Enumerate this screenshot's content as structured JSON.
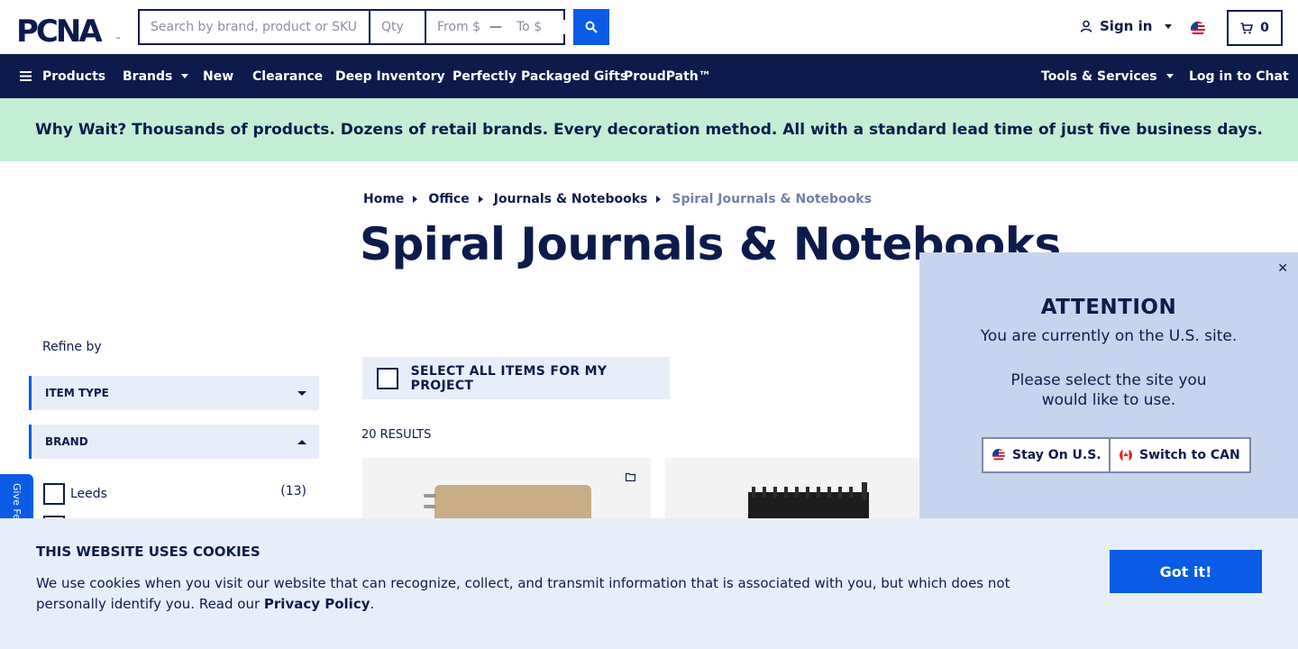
{
  "header": {
    "logo_text": "PCNA",
    "search_placeholder": "Search by brand, product or SKU",
    "qty_placeholder": "Qty",
    "price_from_placeholder": "From $",
    "price_to_placeholder": "To $",
    "signin_label": "Sign in",
    "cart_count": "0"
  },
  "nav": {
    "products": "Products",
    "brands": "Brands",
    "new": "New",
    "clearance": "Clearance",
    "deep_inventory": "Deep Inventory",
    "packaged_gifts": "Perfectly Packaged Gifts",
    "proudpath": "ProudPath™",
    "tools": "Tools & Services",
    "chat": "Log in to Chat"
  },
  "banner": {
    "text": "Why Wait? Thousands of products. Dozens of retail brands. Every decoration method. All with a standard lead time of just five business days."
  },
  "breadcrumb": {
    "items": [
      "Home",
      "Office",
      "Journals & Notebooks"
    ],
    "current": "Spiral Journals & Notebooks"
  },
  "page_title": "Spiral Journals & Notebooks",
  "sidebar": {
    "refine_label": "Refine by",
    "facets": [
      {
        "label": "ITEM TYPE",
        "state": "collapsed"
      },
      {
        "label": "BRAND",
        "state": "expanded"
      }
    ],
    "brand_options": [
      {
        "label": "Leeds",
        "count": "(13)"
      }
    ],
    "feedback_label": "Give Fe"
  },
  "results": {
    "select_all_label": "SELECT ALL ITEMS FOR MY PROJECT",
    "count_label": "20 RESULTS"
  },
  "modal": {
    "title": "ATTENTION",
    "line1": "You are currently on the U.S. site.",
    "line2a": "Please select the site you",
    "line2b": "would like to use.",
    "stay_label": "Stay On U.S.",
    "switch_label": "Switch to CAN",
    "close_glyph": "✕"
  },
  "cookie": {
    "title": "THIS WEBSITE USES COOKIES",
    "text_before": "We use cookies when you visit our website that can recognize, collect, and transmit information that is associated with you, but which does not personally identify you. Read our ",
    "link": "Privacy Policy",
    "text_after": ".",
    "button": "Got it!"
  },
  "colors": {
    "navy": "#0d1b4c",
    "accent_blue": "#0a5ce6",
    "banner_green": "#c3eed5",
    "modal_bg": "#c6d4ee",
    "panel_bg": "#e8eef9"
  }
}
